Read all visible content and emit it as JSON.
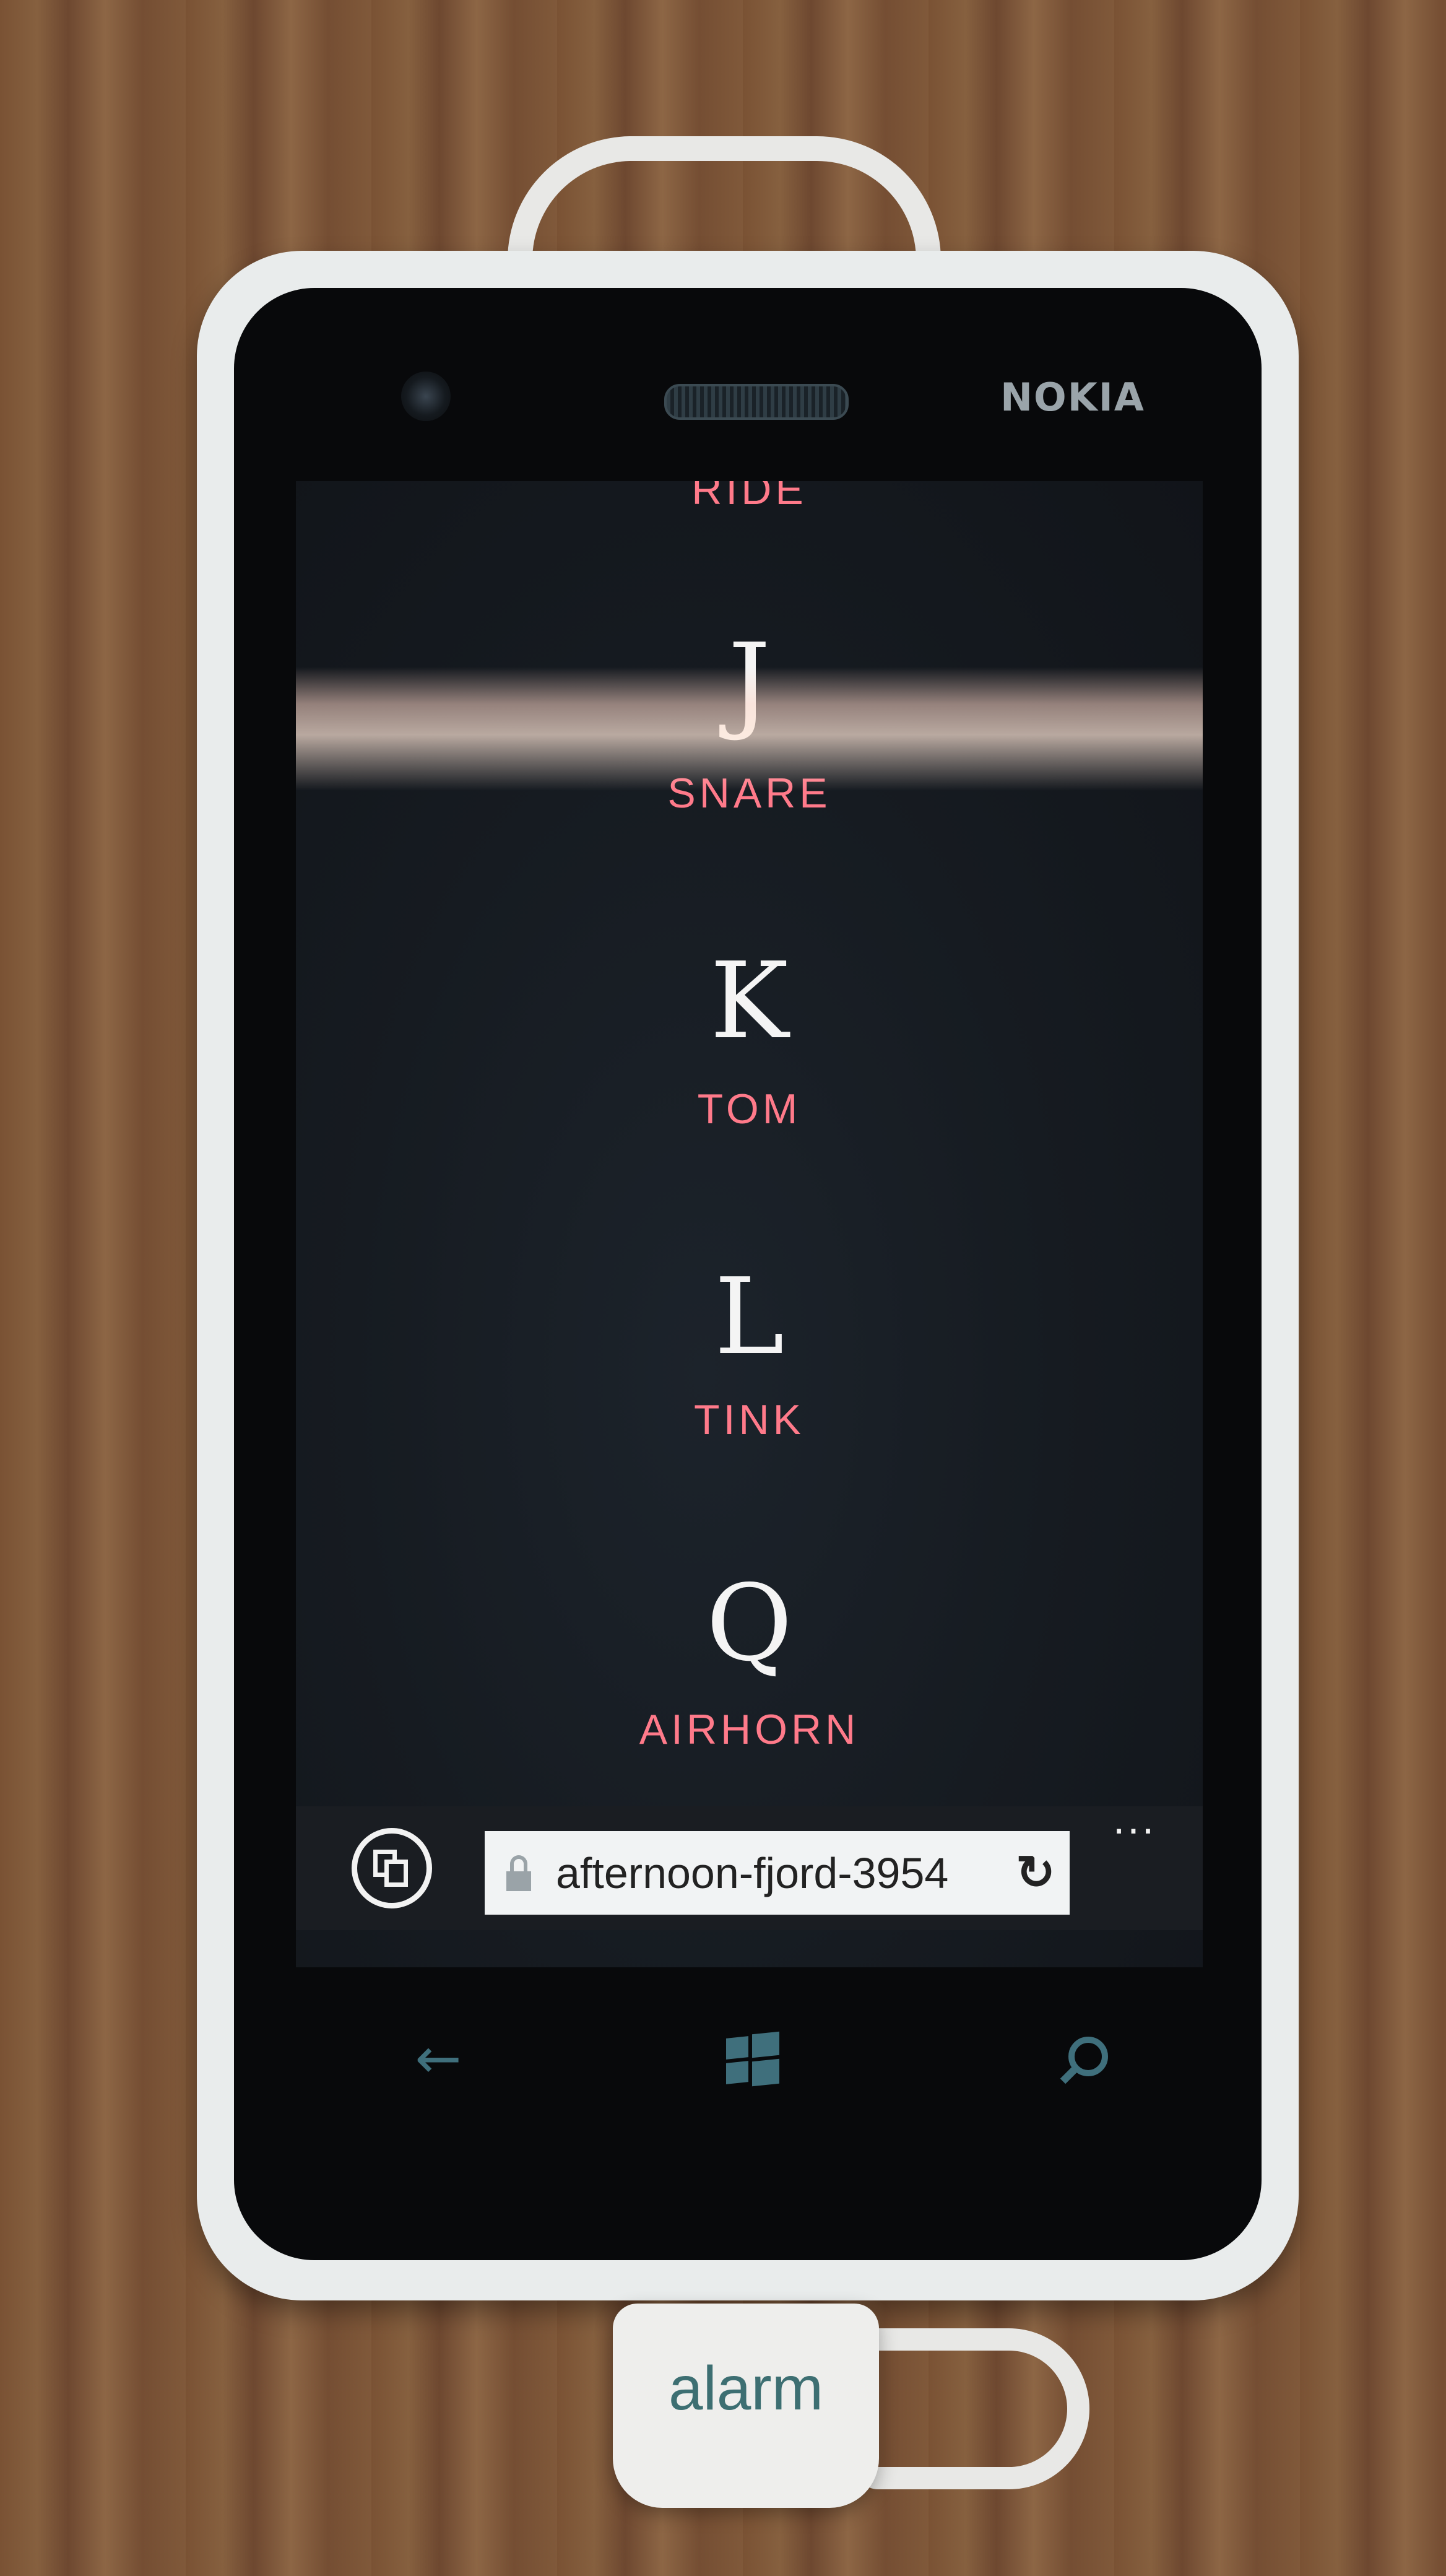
{
  "device": {
    "brand": "NOKIA",
    "alarm_tag": "alarm"
  },
  "page": {
    "keys": [
      {
        "letter": "",
        "sound": "RIDE"
      },
      {
        "letter": "J",
        "sound": "SNARE"
      },
      {
        "letter": "K",
        "sound": "TOM"
      },
      {
        "letter": "L",
        "sound": "TINK"
      },
      {
        "letter": "Q",
        "sound": "AIRHORN"
      }
    ],
    "letter_color": "#f4f4f4",
    "sound_color": "#ff7a8a"
  },
  "browser": {
    "url": "afternoon-fjord-3954",
    "more_label": "..."
  },
  "nav": {
    "back_icon": "back-arrow-icon",
    "start_icon": "windows-icon",
    "search_icon": "search-icon",
    "accent": "#3f6f7c"
  }
}
